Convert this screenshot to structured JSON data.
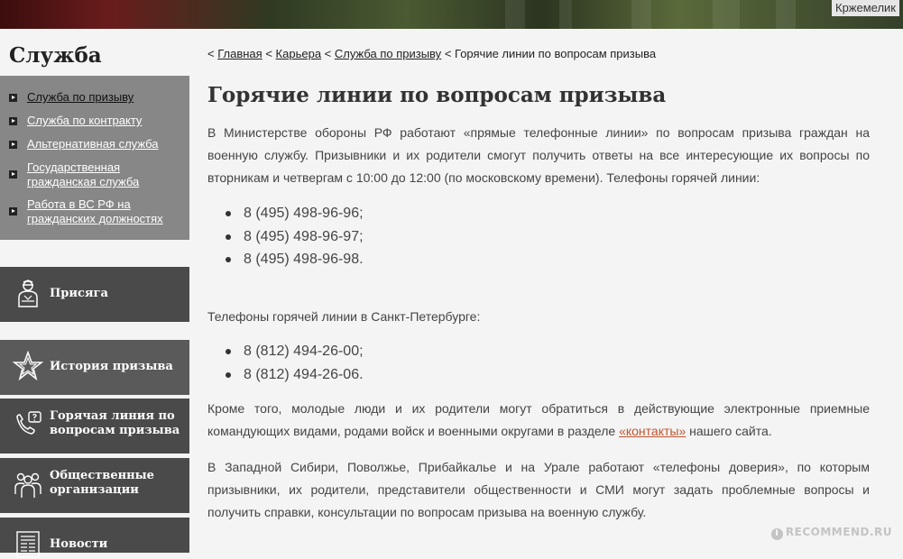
{
  "header": {
    "user_name": "Кржемелик"
  },
  "sidebar": {
    "title": "Служба",
    "menu": [
      {
        "label": "Служба по призыву",
        "active": true
      },
      {
        "label": "Служба по контракту"
      },
      {
        "label": "Альтернативная служба"
      },
      {
        "label": "Государственная\nгражданская служба"
      },
      {
        "label": "Работа в ВС РФ на\nгражданских должностях"
      }
    ],
    "blocks": [
      {
        "label": "Присяга",
        "icon": "soldier-icon"
      },
      {
        "label": "История призыва",
        "icon": "star-icon"
      },
      {
        "label": "Горячая линия по\nвопросам призыва",
        "icon": "phone-question-icon"
      },
      {
        "label": "Общественные\nорганизации",
        "icon": "people-icon"
      },
      {
        "label": "Новости",
        "icon": "newspaper-icon"
      }
    ]
  },
  "breadcrumb": {
    "sep": "<",
    "links": [
      "Главная",
      "Карьера",
      "Служба по призыву"
    ],
    "current": "Горячие линии по вопросам призыва"
  },
  "article": {
    "title": "Горячие линии по вопросам призыва",
    "intro": "В Министерстве обороны РФ работают «прямые телефонные линии» по вопросам призыва граждан на военную службу. Призывники и их родители смогут получить ответы на все интересующие их вопросы по вторникам и четвергам с 10:00 до 12:00 (по московскому времени). Телефоны горячей линии:",
    "moscow_phones": [
      "8 (495) 498-96-96;",
      "8 (495) 498-96-97;",
      "8 (495) 498-96-98."
    ],
    "spb_intro": "Телефоны горячей линии в Санкт-Петербурге:",
    "spb_phones": [
      "8 (812) 494-26-00;",
      "8 (812) 494-26-06."
    ],
    "contacts_before": "Кроме того, молодые люди и их родители могут обратиться в действующие  электронные приемные командующих видами, родами войск и военными округами в разделе ",
    "contacts_link": "«контакты»",
    "contacts_after": " нашего сайта.",
    "regions": "В Западной Сибири, Поволжье, Прибайкалье и на Урале работают «телефоны доверия», по которым призывники, их родители, представители общественности и СМИ могут задать проблемные вопросы и получить справки, консультации по вопросам призыва на военную службу."
  },
  "watermark": {
    "text": "RECOMMEND.RU",
    "mark": "I"
  }
}
